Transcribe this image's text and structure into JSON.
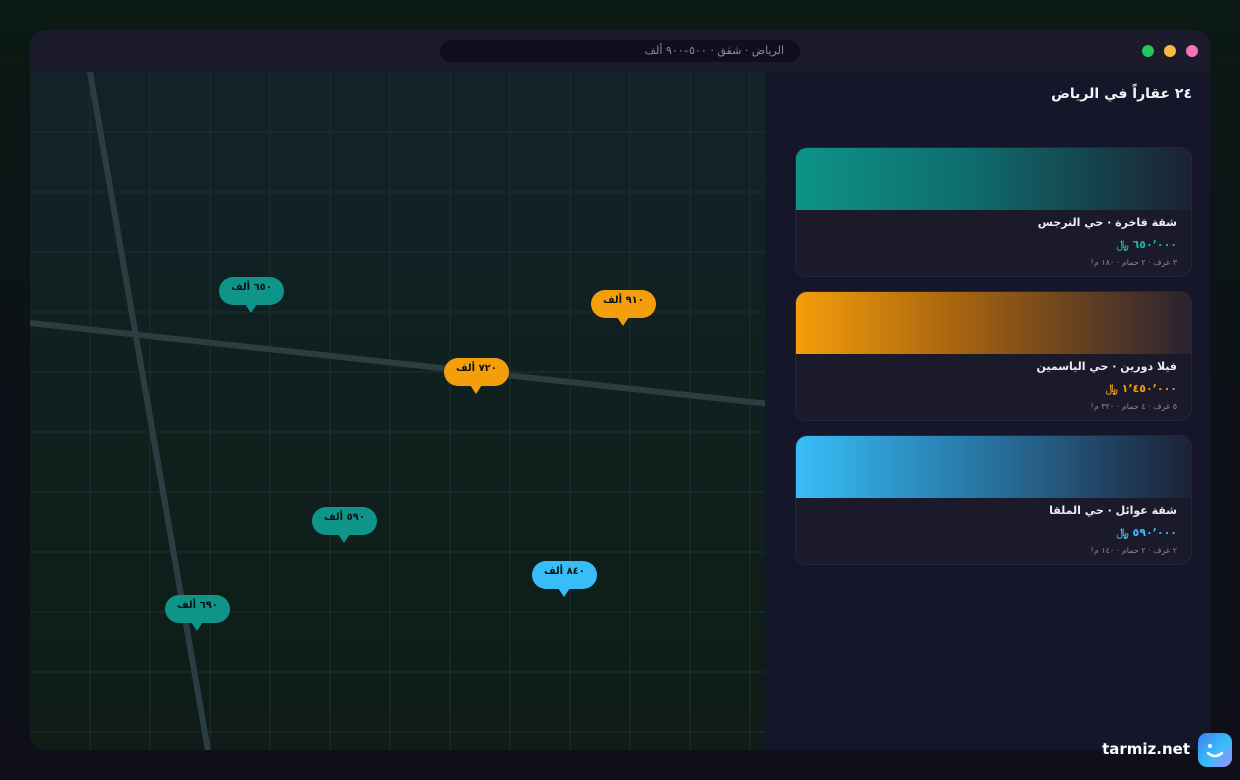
{
  "window": {
    "address": "الرياض · شقق · ٥٠٠–٩٠٠ ألف"
  },
  "map": {
    "pins": [
      {
        "label": "٦٥٠ ألف",
        "color": "teal"
      },
      {
        "label": "٩١٠ ألف",
        "color": "amber"
      },
      {
        "label": "٧٢٠ ألف",
        "color": "amber"
      },
      {
        "label": "٥٩٠ ألف",
        "color": "teal"
      },
      {
        "label": "٨٤٠ ألف",
        "color": "sky"
      },
      {
        "label": "٦٩٠ ألف",
        "color": "teal"
      }
    ]
  },
  "panel": {
    "title": "٢٤ عقاراً في الرياض",
    "listings": [
      {
        "name": "شقة فاخرة · حي النرجس",
        "price": "٦٥٠٬٠٠٠ ﷼",
        "meta": "٣ غرف · ٢ حمام · ١٨٠ م²",
        "accent": "#14b8a6"
      },
      {
        "name": "فيلا دورين · حي الياسمين",
        "price": "١٬٤٥٠٬٠٠٠ ﷼",
        "meta": "٥ غرف · ٤ حمام · ٣٢٠ م²",
        "accent": "#f59e0b"
      },
      {
        "name": "شقة عوائل · حي الملقا",
        "price": "٥٩٠٬٠٠٠ ﷼",
        "meta": "٢ غرف · ٢ حمام · ١٤٠ م²",
        "accent": "#38bdf8"
      }
    ]
  },
  "brand": {
    "text": "tarmiz.net"
  }
}
